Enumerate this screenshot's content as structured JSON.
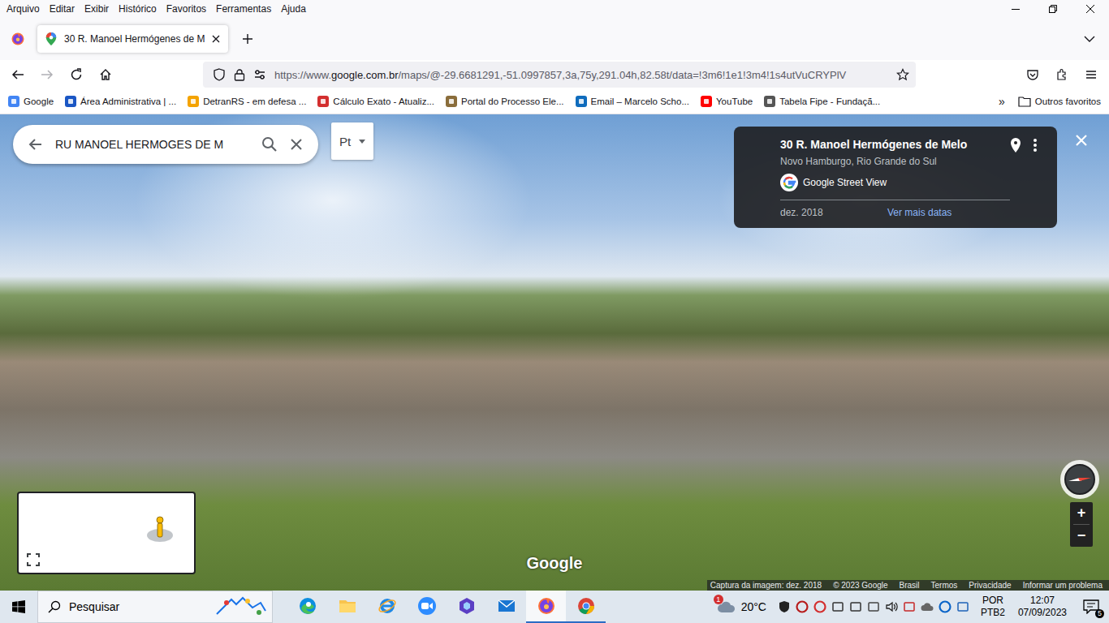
{
  "menu": [
    "Arquivo",
    "Editar",
    "Exibir",
    "Histórico",
    "Favoritos",
    "Ferramentas",
    "Ajuda"
  ],
  "tabs": [
    {
      "label": "30 R. Manoel Hermógenes de M",
      "selected": true
    }
  ],
  "address_bar": {
    "prefix": "https://www.",
    "domain": "google.com.br",
    "path": "/maps/@-29.6681291,-51.0997857,3a,75y,291.04h,82.58t/data=!3m6!1e1!3m4!1s4utVuCRYPlV"
  },
  "bookmarks": [
    {
      "label": "Google",
      "color": "#4285f4"
    },
    {
      "label": "Área Administrativa | ...",
      "color": "#1a56c4"
    },
    {
      "label": "DetranRS - em defesa ...",
      "color": "#f4a300"
    },
    {
      "label": "Cálculo Exato - Atualiz...",
      "color": "#d32f2f"
    },
    {
      "label": "Portal do Processo Ele...",
      "color": "#8a6d3b"
    },
    {
      "label": "Email – Marcelo Scho...",
      "color": "#0f6cbd"
    },
    {
      "label": "YouTube",
      "color": "#ff0000"
    },
    {
      "label": "Tabela Fipe - Fundaçã...",
      "color": "#555555"
    }
  ],
  "bookmarks_overflow": "»",
  "other_bookmarks": "Outros favoritos",
  "street_view": {
    "search": {
      "value": "RU MANOEL HERMOGES DE M"
    },
    "input_tool": "Pt",
    "place": {
      "title": "30 R. Manoel Hermógenes de Melo",
      "subtitle": "Novo Hamburgo, Rio Grande do Sul",
      "source": "Google Street View",
      "date": "dez. 2018",
      "more_dates": "Ver mais datas"
    },
    "watermark": "Google",
    "zoom": {
      "in": "+",
      "out": "−"
    },
    "footer": [
      "Captura da imagem: dez. 2018",
      "© 2023 Google",
      "Brasil",
      "Termos",
      "Privacidade",
      "Informar um problema"
    ]
  },
  "taskbar": {
    "search_placeholder": "Pesquisar",
    "apps": [
      {
        "kind": "edge",
        "selected": false,
        "running": false
      },
      {
        "kind": "explorer",
        "selected": false,
        "running": false
      },
      {
        "kind": "ie",
        "selected": false,
        "running": false
      },
      {
        "kind": "zoom",
        "selected": false,
        "running": false
      },
      {
        "kind": "app",
        "selected": false,
        "running": false
      },
      {
        "kind": "mail",
        "selected": false,
        "running": false
      },
      {
        "kind": "firefox",
        "selected": true,
        "running": true
      },
      {
        "kind": "chrome",
        "selected": false,
        "running": true
      }
    ],
    "weather": {
      "temp": "20°C",
      "badge": "1"
    },
    "language": {
      "code": "POR",
      "layout": "PTB2"
    },
    "clock": {
      "time": "12:07",
      "date": "07/09/2023"
    },
    "notifications": "5"
  }
}
